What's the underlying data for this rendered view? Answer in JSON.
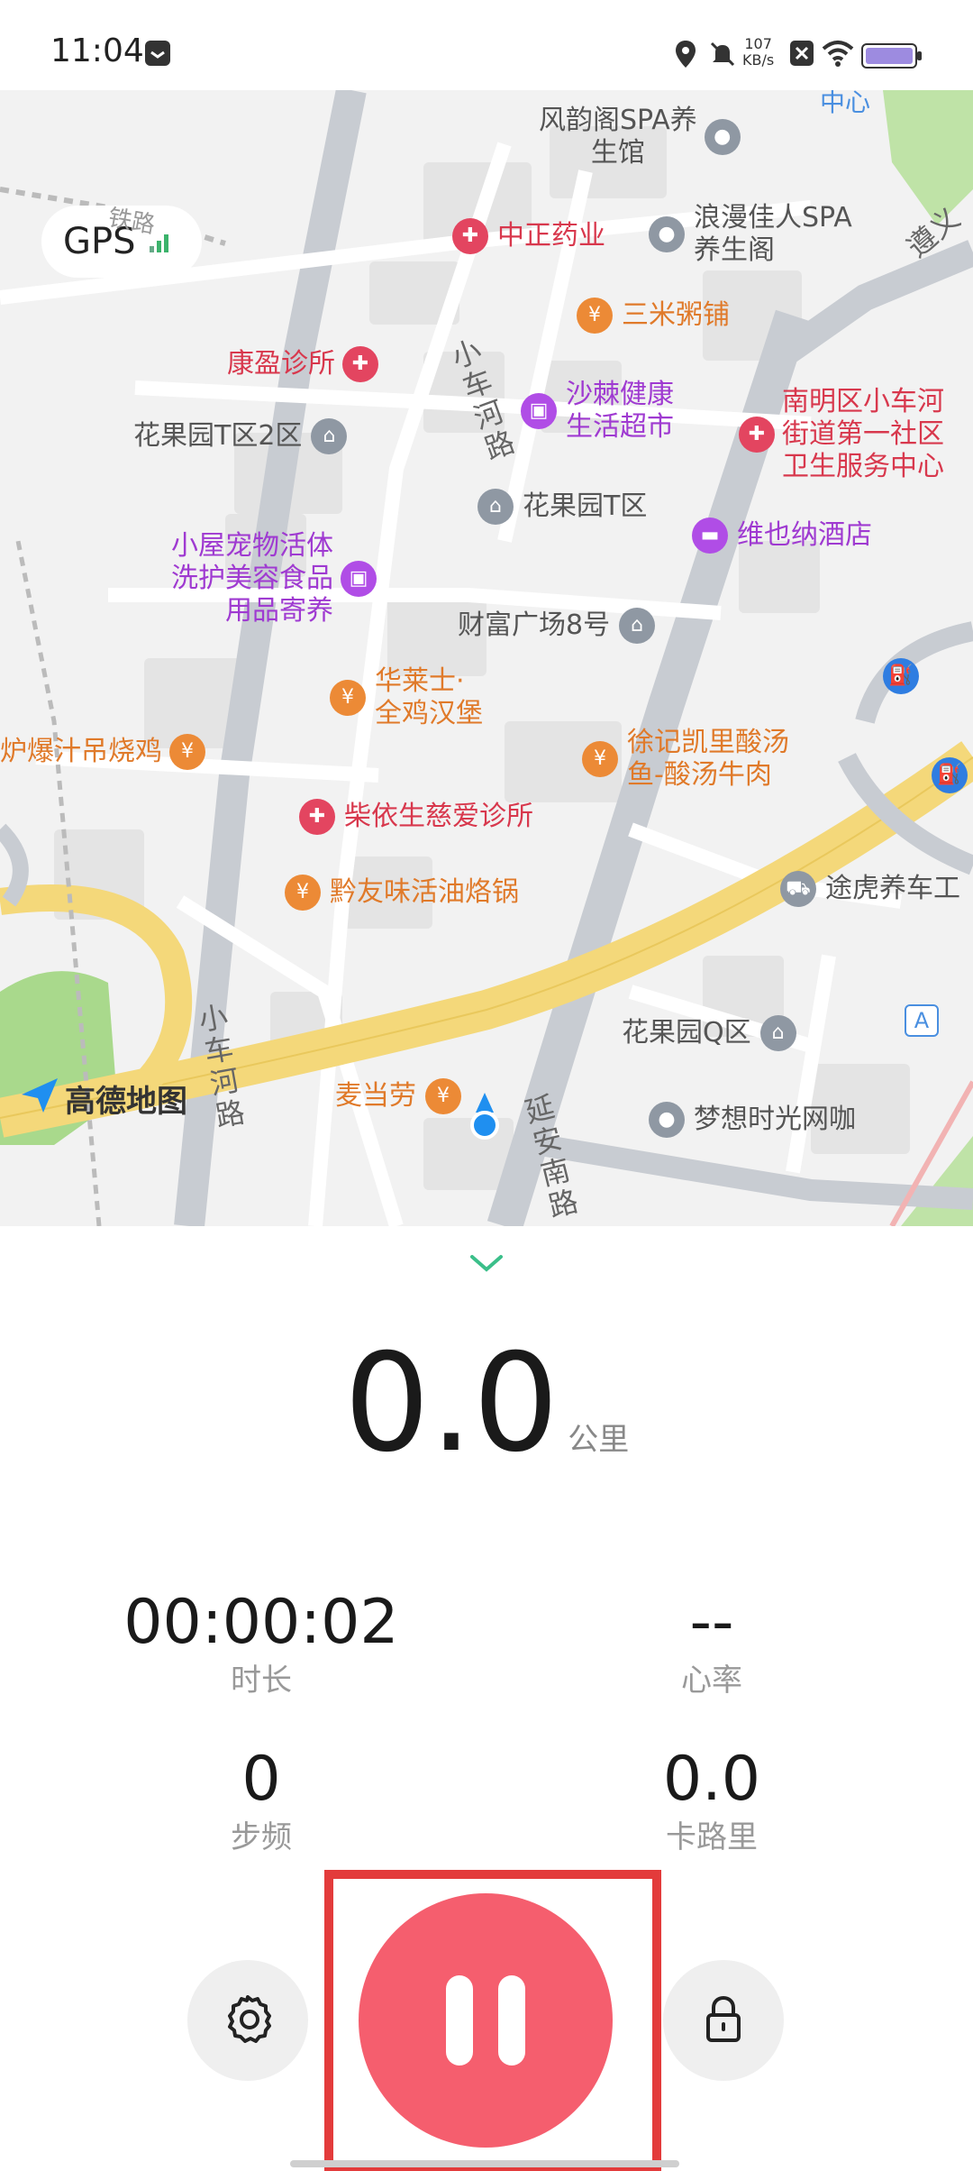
{
  "status_bar": {
    "time": "11:04",
    "net_speed_value": "107",
    "net_speed_unit": "KB/s",
    "icons": [
      "message-icon",
      "location-icon",
      "mute-icon",
      "close-box-icon",
      "wifi-icon",
      "battery-icon"
    ]
  },
  "map": {
    "gps_label": "GPS",
    "provider_logo": "高德地图",
    "pois": [
      {
        "name": "风韵阁SPA养\n生馆",
        "type": "gray"
      },
      {
        "name": "中正药业",
        "type": "red"
      },
      {
        "name": "浪漫佳人SPA\n养生阁",
        "type": "gray"
      },
      {
        "name": "三米粥铺",
        "type": "orange"
      },
      {
        "name": "康盈诊所",
        "type": "red"
      },
      {
        "name": "沙棘健康\n生活超市",
        "type": "purple"
      },
      {
        "name": "南明区小车河\n街道第一社区\n卫生服务中心",
        "type": "red"
      },
      {
        "name": "花果园T区2区",
        "type": "gray"
      },
      {
        "name": "花果园T区",
        "type": "gray"
      },
      {
        "name": "小屋宠物活体\n洗护美容食品\n用品寄养",
        "type": "purple"
      },
      {
        "name": "维也纳酒店",
        "type": "purple"
      },
      {
        "name": "财富广场8号",
        "type": "gray"
      },
      {
        "name": "华莱士·\n全鸡汉堡",
        "type": "orange"
      },
      {
        "name": "炉爆汁吊烧鸡",
        "type": "orange"
      },
      {
        "name": "徐记凯里酸汤\n鱼-酸汤牛肉",
        "type": "orange"
      },
      {
        "name": "柴依生慈爱诊所",
        "type": "red"
      },
      {
        "name": "黔友味活油烙锅",
        "type": "orange"
      },
      {
        "name": "途虎养车工",
        "type": "gray"
      },
      {
        "name": "花果园Q区",
        "type": "gray"
      },
      {
        "name": "麦当劳",
        "type": "orange"
      },
      {
        "name": "梦想时光网咖",
        "type": "gray"
      }
    ],
    "roads": [
      "小车河路",
      "小车河路",
      "延安南路",
      "遵义",
      "铁路",
      "中心"
    ],
    "marker_letter": "A"
  },
  "workout": {
    "distance_value": "0.0",
    "distance_unit": "公里",
    "duration_value": "00:00:02",
    "duration_label": "时长",
    "heart_rate_value": "--",
    "heart_rate_label": "心率",
    "cadence_value": "0",
    "cadence_label": "步频",
    "calories_value": "0.0",
    "calories_label": "卡路里"
  },
  "controls": {
    "settings_icon": "gear-icon",
    "pause_icon": "pause-icon",
    "lock_icon": "lock-icon",
    "accent_color": "#f55e6e"
  }
}
